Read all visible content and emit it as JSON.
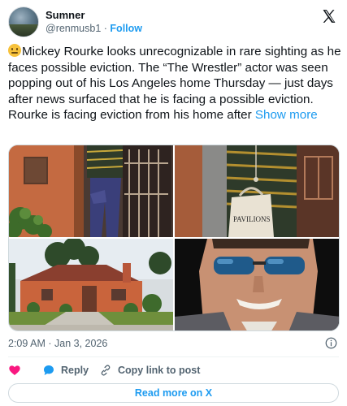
{
  "author": {
    "display_name": "Sumner",
    "handle": "@renmusb1",
    "separator": "·",
    "follow_label": "Follow"
  },
  "tweet": {
    "emoji": "confused-face-emoji",
    "text": "Mickey Rourke looks unrecognizable in rare sighting as he faces possible eviction. The “The Wrestler” actor was seen popping out of his Los Angeles home Thursday — just days after news surfaced that he is facing a possible eviction. Rourke is facing eviction from his home after",
    "show_more_label": "Show more"
  },
  "media": {
    "photos": [
      {
        "subject": "man-leaving-doorway-photo"
      },
      {
        "subject": "man-carrying-bag-photo",
        "bag_text": "PAVILIONS"
      },
      {
        "subject": "house-exterior-photo"
      },
      {
        "subject": "man-sunglasses-portrait-photo"
      }
    ]
  },
  "meta": {
    "time": "2:09 AM",
    "separator": "·",
    "date": "Jan 3, 2026"
  },
  "actions": {
    "reply_label": "Reply",
    "copy_label": "Copy link to post"
  },
  "footer": {
    "read_more_label": "Read more on X"
  },
  "colors": {
    "accent": "#1d9bf0",
    "like": "#f91880",
    "text": "#0f1419",
    "muted": "#536471",
    "border": "#cfd9de"
  }
}
